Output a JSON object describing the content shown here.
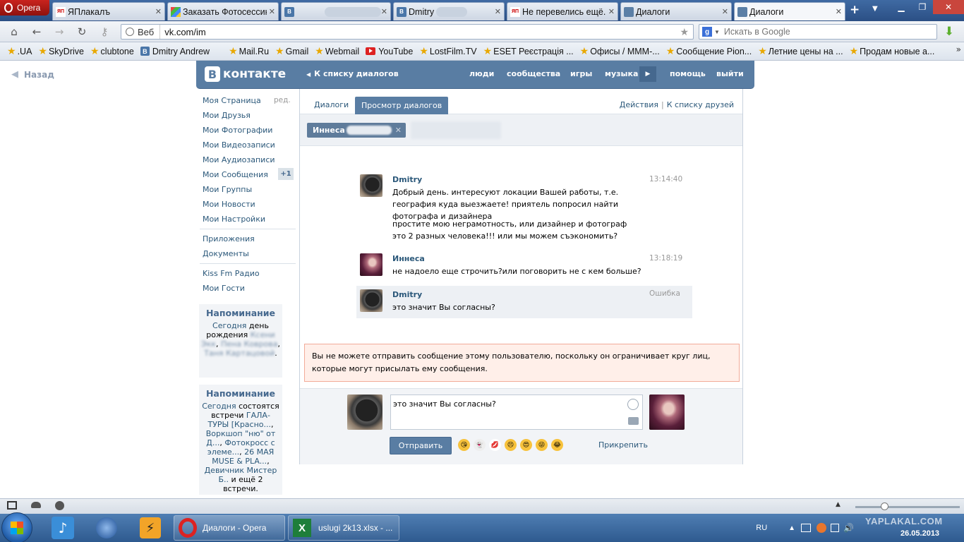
{
  "browser": {
    "opera_label": "Opera",
    "tabs": [
      {
        "label": "ЯПлакалъ",
        "icon": "yaplakal-favicon",
        "fav": "ЯП"
      },
      {
        "label": "Заказать Фотосессию",
        "icon": "multi-color-favicon",
        "fav": ""
      },
      {
        "label": "",
        "icon": "vk-favicon",
        "fav": "В"
      },
      {
        "label": "Dmitry",
        "icon": "vk-favicon",
        "fav": "В"
      },
      {
        "label": "Не перевелись ещё...",
        "icon": "yaplakal-favicon",
        "fav": "ЯП"
      },
      {
        "label": "Диалоги",
        "icon": "message-favicon",
        "fav": ""
      },
      {
        "label": "Диалоги",
        "icon": "message-favicon",
        "fav": ""
      }
    ],
    "address": {
      "web_label": "Веб",
      "url": "vk.com/im"
    },
    "search": {
      "placeholder": "Искать в Google",
      "engine_letter": "g"
    },
    "bookmarks": [
      {
        "label": ".UA",
        "icon": "star-icon"
      },
      {
        "label": "SkyDrive",
        "icon": "star-icon"
      },
      {
        "label": "clubtone",
        "icon": "star-icon"
      },
      {
        "label": "Dmitry Andrew",
        "icon": "vk-icon"
      },
      {
        "label": "Mail.Ru",
        "icon": "star-icon"
      },
      {
        "label": "Gmail",
        "icon": "star-icon"
      },
      {
        "label": "Webmail",
        "icon": "star-icon"
      },
      {
        "label": "YouTube",
        "icon": "youtube-icon"
      },
      {
        "label": "LostFilm.TV",
        "icon": "star-icon"
      },
      {
        "label": "ESET Реєстрація ...",
        "icon": "star-icon"
      },
      {
        "label": "Офисы / МММ-...",
        "icon": "star-icon"
      },
      {
        "label": "Сообщение Pion...",
        "icon": "star-icon"
      },
      {
        "label": "Летние цены на ...",
        "icon": "star-icon"
      },
      {
        "label": "Продам новые а...",
        "icon": "star-icon"
      }
    ],
    "bookmarks_more": "»"
  },
  "page": {
    "back_label": "Назад",
    "logo_text": "контакте",
    "logo_letter": "В",
    "back_to_list": "К списку диалогов",
    "nav": [
      "люди",
      "сообщества",
      "игры",
      "музыка",
      "помощь",
      "выйти"
    ],
    "sidebar": {
      "items": [
        "Моя Страница",
        "Мои Друзья",
        "Мои Фотографии",
        "Мои Видеозаписи",
        "Мои Аудиозаписи",
        "Мои Сообщения",
        "Мои Группы",
        "Мои Новости",
        "Мои Настройки"
      ],
      "edit_label": "ред.",
      "messages_badge": "+1",
      "items2": [
        "Приложения",
        "Документы"
      ],
      "items3": [
        "Kiss Fm Радио",
        "Мои Гости"
      ]
    },
    "reminder1": {
      "title": "Напоминание",
      "today": "Сегодня",
      "text": "день рождения",
      "blur1": "Ксени",
      "blur2": "Экк",
      "blur3": "Пена Коврова",
      "blur4": "Таня Картацовой"
    },
    "reminder2": {
      "title": "Напоминание",
      "today": "Сегодня",
      "t1": "состоятся встречи",
      "l1": "ГАЛА-ТУРЫ [Красно...",
      "l2": "Воркшоп \"ню\" от Д...",
      "l3": "Фотокросс с элеме...",
      "l4": "26 МАЯ MUSE & PLA...",
      "l5": "Девичник Мистер Б..",
      "t2": "и ещё 2 встречи."
    },
    "tabs": {
      "dialogs": "Диалоги",
      "view": "Просмотр диалогов",
      "actions": "Действия",
      "friends": "К списку друзей",
      "sep": "|"
    },
    "peer": {
      "name": "Иннеса"
    },
    "messages": [
      {
        "author": "Dmitry",
        "time": "13:14:40",
        "text1": "Добрый день. интересуют локации Вашей работы, т.е. география куда выезжаете! приятель попросил найти фотографа и дизайнера",
        "text2": "простите мою неграмотность, или дизайнер и фотограф это 2 разных человека!!! или мы можем съэкономить?"
      },
      {
        "author": "Иннеса",
        "time": "13:18:19",
        "text1": "не надоело еще строчить?или поговорить не с кем больше?"
      },
      {
        "author": "Dmitry",
        "time": "Ошибка",
        "text1": "это значит Вы согласны?"
      }
    ],
    "warning": "Вы не можете отправить сообщение этому пользователю, поскольку он ограничивает круг лиц, которые могут присылать ему сообщения.",
    "compose": {
      "text": "это значит Вы согласны?",
      "send": "Отправить",
      "attach": "Прикрепить"
    }
  },
  "taskbar": {
    "tasks": [
      {
        "label": "Диалоги - Opera"
      },
      {
        "label": "uslugi 2k13.xlsx - ..."
      }
    ],
    "lang": "RU",
    "date": "26.05.2013",
    "watermark": "YAPLAKAL.COM"
  },
  "colors": {
    "vk_blue": "#597da3",
    "link": "#2b587a",
    "warning_bg": "#ffefe9",
    "warning_border": "#f2ab99"
  }
}
